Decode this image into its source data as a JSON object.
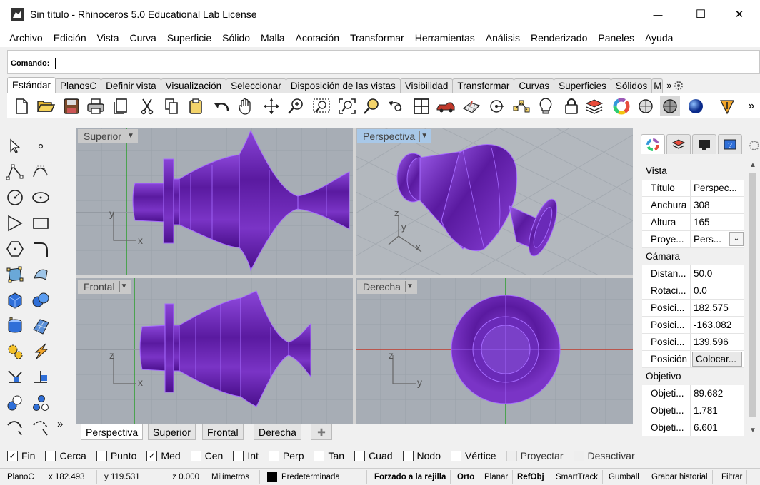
{
  "window": {
    "title": "Sin título - Rhinoceros 5.0 Educational Lab License",
    "minimize": "—",
    "maximize": "☐",
    "close": "✕"
  },
  "menu": [
    "Archivo",
    "Edición",
    "Vista",
    "Curva",
    "Superficie",
    "Sólido",
    "Malla",
    "Acotación",
    "Transformar",
    "Herramientas",
    "Análisis",
    "Renderizado",
    "Paneles",
    "Ayuda"
  ],
  "command": {
    "label": "Comando:",
    "value": ""
  },
  "toolbar_tabs": [
    "Estándar",
    "PlanosC",
    "Definir vista",
    "Visualización",
    "Seleccionar",
    "Disposición de las vistas",
    "Visibilidad",
    "Transformar",
    "Curvas",
    "Superficies",
    "Sólidos",
    "M"
  ],
  "toolbar_tabs_more": "»",
  "toolbar_more": "»",
  "left_more": "»",
  "viewports": [
    {
      "name": "Superior",
      "active": false,
      "axis_a": "y",
      "axis_b": "x"
    },
    {
      "name": "Perspectiva",
      "active": true,
      "axis_a": "z",
      "axis_b": "y",
      "axis_c": "x"
    },
    {
      "name": "Frontal",
      "active": false,
      "axis_a": "z",
      "axis_b": "x"
    },
    {
      "name": "Derecha",
      "active": false,
      "axis_a": "z",
      "axis_b": "y"
    }
  ],
  "viewport_tabs": [
    "Perspectiva",
    "Superior",
    "Frontal",
    "Derecha"
  ],
  "viewport_tab_add": "✚",
  "properties": {
    "sections": [
      {
        "title": "Vista",
        "rows": [
          {
            "k": "Título",
            "v": "Perspec..."
          },
          {
            "k": "Anchura",
            "v": "308"
          },
          {
            "k": "Altura",
            "v": "165"
          },
          {
            "k": "Proye...",
            "v": "Pers...",
            "dropdown": true
          }
        ]
      },
      {
        "title": "Cámara",
        "rows": [
          {
            "k": "Distan...",
            "v": "50.0"
          },
          {
            "k": "Rotaci...",
            "v": "0.0"
          },
          {
            "k": "Posici...",
            "v": "182.575"
          },
          {
            "k": "Posici...",
            "v": "-163.082"
          },
          {
            "k": "Posici...",
            "v": "139.596"
          },
          {
            "k": "Posición",
            "v": "Colocar...",
            "button": true
          }
        ]
      },
      {
        "title": "Objetivo",
        "rows": [
          {
            "k": "Objeti...",
            "v": "89.682"
          },
          {
            "k": "Objeti...",
            "v": "1.781"
          },
          {
            "k": "Objeti...",
            "v": "6.601"
          }
        ]
      }
    ]
  },
  "osnaps": [
    {
      "label": "Fin",
      "checked": true,
      "enabled": true
    },
    {
      "label": "Cerca",
      "checked": false,
      "enabled": true
    },
    {
      "label": "Punto",
      "checked": false,
      "enabled": true
    },
    {
      "label": "Med",
      "checked": true,
      "enabled": true
    },
    {
      "label": "Cen",
      "checked": false,
      "enabled": true
    },
    {
      "label": "Int",
      "checked": false,
      "enabled": true
    },
    {
      "label": "Perp",
      "checked": false,
      "enabled": true
    },
    {
      "label": "Tan",
      "checked": false,
      "enabled": true
    },
    {
      "label": "Cuad",
      "checked": false,
      "enabled": true
    },
    {
      "label": "Nodo",
      "checked": false,
      "enabled": true
    },
    {
      "label": "Vértice",
      "checked": false,
      "enabled": true
    },
    {
      "label": "Proyectar",
      "checked": false,
      "enabled": false
    },
    {
      "label": "Desactivar",
      "checked": false,
      "enabled": false
    }
  ],
  "status": {
    "cplane": "PlanoC",
    "x": "x 182.493",
    "y": "y 119.531",
    "z": "z 0.000",
    "units": "Milímetros",
    "layer": "Predeterminada",
    "buttons": [
      "Forzado a la rejilla",
      "Orto",
      "Planar",
      "RefObj",
      "SmartTrack",
      "Gumball",
      "Grabar historial",
      "Filtrar"
    ]
  },
  "colors": {
    "object": "#6a1fb5",
    "object_edge": "#9b59ff",
    "viewport_bg": "#a7adb5",
    "x_axis": "#c0392b",
    "y_axis": "#2e9e2e"
  }
}
